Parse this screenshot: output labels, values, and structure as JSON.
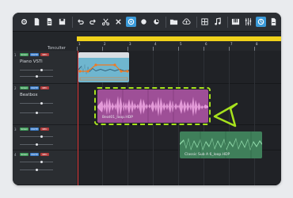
{
  "colors": {
    "accent_yellow": "#f0d21b",
    "highlight_green": "#a7e21d",
    "playhead_red": "#e0393a",
    "clip_purple": "#b25ba8",
    "clip_green": "#3f8a5f",
    "clip_blue": "#5aa6c8"
  },
  "toolbar": {
    "icons": [
      "gear-icon",
      "new-file-icon",
      "open-file-icon",
      "save-icon",
      "undo-icon",
      "redo-icon",
      "scissors-icon",
      "delete-icon",
      "target-icon",
      "record-icon",
      "loop-icon",
      "folder-icon",
      "cloud-upload-icon",
      "grid-icon",
      "music-note-icon",
      "piano-icon",
      "mixer-icon",
      "tempo-icon",
      "export-icon"
    ]
  },
  "ruler": {
    "labels": [
      "1",
      "2",
      "3",
      "4",
      "5",
      "6",
      "7",
      "8"
    ]
  },
  "timecode_label": "Tonculter",
  "tracks": [
    {
      "number": "1",
      "name": "Piano VSTi",
      "buttons": [
        "SOLO",
        "MUTE",
        "REC"
      ]
    },
    {
      "number": "2",
      "name": "Beatbox",
      "buttons": [
        "SOLO",
        "MUTE",
        "REC"
      ]
    },
    {
      "number": "3",
      "name": "",
      "buttons": [
        "SOLO",
        "MUTE",
        "REC"
      ]
    },
    {
      "number": "4",
      "name": "",
      "buttons": [
        "SOLO",
        "MUTE",
        "REC"
      ]
    }
  ],
  "clips": {
    "purple": {
      "label": "Beat01_loop.HDP"
    },
    "green": {
      "label": "Classic Sub A 6_loop.HDP"
    }
  }
}
